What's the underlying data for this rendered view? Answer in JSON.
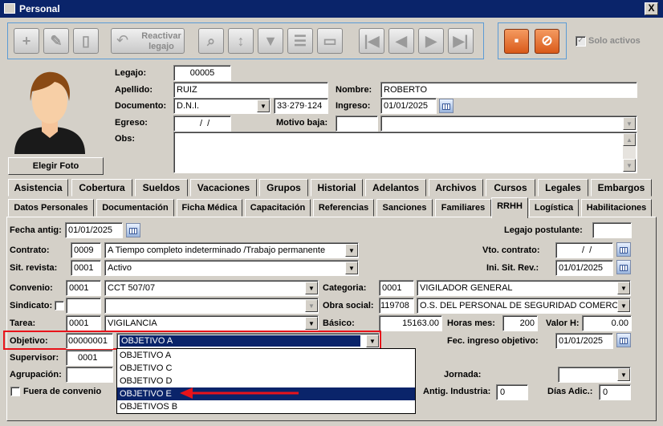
{
  "window": {
    "title": "Personal",
    "close": "X"
  },
  "toolbar": {
    "reactivar": "Reactivar legajo",
    "solo_activos": "Solo activos"
  },
  "header": {
    "legajo_label": "Legajo:",
    "legajo": "00005",
    "apellido_label": "Apellido:",
    "apellido": "RUIZ",
    "nombre_label": "Nombre:",
    "nombre": "ROBERTO",
    "documento_label": "Documento:",
    "doc_tipo": "D.N.I.",
    "doc_num": "33·279·124",
    "ingreso_label": "Ingreso:",
    "ingreso": "01/01/2025",
    "egreso_label": "Egreso:",
    "egreso": "  /  /",
    "motivo_label": "Motivo baja:",
    "obs_label": "Obs:",
    "elegir_foto": "Elegir Foto"
  },
  "tabs_row1": [
    "Asistencia",
    "Cobertura",
    "Sueldos",
    "Vacaciones",
    "Grupos",
    "Historial",
    "Adelantos",
    "Archivos",
    "Cursos",
    "Legales",
    "Embargos"
  ],
  "tabs_row2": [
    "Datos Personales",
    "Documentación",
    "Ficha Médica",
    "Capacitación",
    "Referencias",
    "Sanciones",
    "Familiares",
    "RRHH",
    "Logística",
    "Habilitaciones"
  ],
  "rrhh": {
    "fecha_antig_label": "Fecha antig:",
    "fecha_antig": "01/01/2025",
    "legajo_post_label": "Legajo postulante:",
    "contrato_label": "Contrato:",
    "contrato_cod": "0009",
    "contrato": "A Tiempo completo indeterminado /Trabajo permanente",
    "vto_label": "Vto. contrato:",
    "vto": "  /  /",
    "sit_label": "Sit. revista:",
    "sit_cod": "0001",
    "sit": "Activo",
    "ini_label": "Ini. Sit. Rev.:",
    "ini": "01/01/2025",
    "convenio_label": "Convenio:",
    "convenio_cod": "0001",
    "convenio": "CCT 507/07",
    "categoria_label": "Categoria:",
    "categoria_cod": "0001",
    "categoria": "VIGILADOR GENERAL",
    "sindicato_label": "Sindicato:",
    "obra_label": "Obra social:",
    "obra_cod": "119708",
    "obra": "O.S. DEL PERSONAL DE SEGURIDAD COMERCIAL, ",
    "tarea_label": "Tarea:",
    "tarea_cod": "0001",
    "tarea": "VIGILANCIA",
    "basico_label": "Básico:",
    "basico": "15163.00",
    "horas_label": "Horas mes:",
    "horas": "200",
    "valorh_label": "Valor H:",
    "valorh": "0.00",
    "objetivo_label": "Objetivo:",
    "objetivo_cod": "00000001",
    "objetivo": "OBJETIVO A",
    "fec_obj_label": "Fec. ingreso objetivo:",
    "fec_obj": "01/01/2025",
    "supervisor_label": "Supervisor:",
    "supervisor_cod": "0001",
    "agrupacion_label": "Agrupación:",
    "jornada_label": "Jornada:",
    "fuera_label": "Fuera de convenio",
    "antig_ind_label": "Antig. Industria:",
    "antig_ind": "0",
    "dias_label": "Días Adic.:",
    "dias": "0"
  },
  "dropdown": {
    "items": [
      "OBJETIVO A",
      "OBJETIVO C",
      "OBJETIVO D",
      "OBJETIVO E",
      "OBJETIVOS B"
    ],
    "selected_index": 3
  },
  "colors": {
    "titlebar": "#0a246a",
    "highlight": "#e8131a",
    "selection": "#0a246a",
    "accent_orange": "#e06a28"
  }
}
